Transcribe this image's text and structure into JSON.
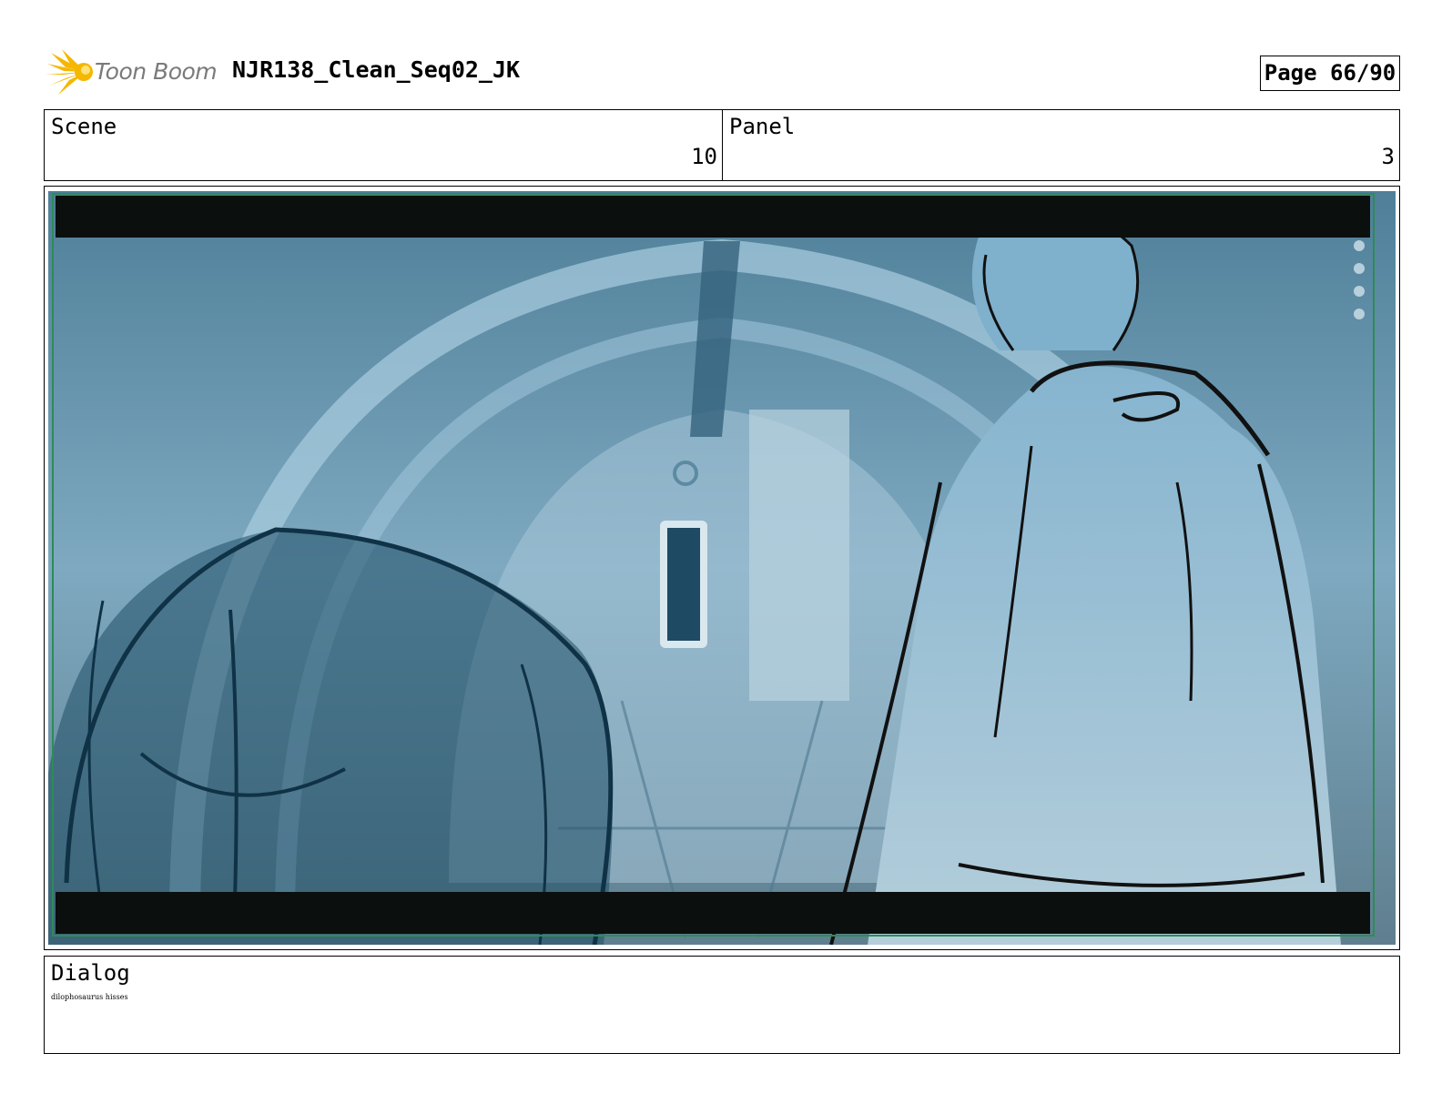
{
  "header": {
    "logo_text": "Toon Boom",
    "project_title": "NJR138_Clean_Seq02_JK",
    "page_label": "Page 66/90"
  },
  "info": {
    "scene_label": "Scene",
    "scene_value": "10",
    "panel_label": "Panel",
    "panel_value": "3"
  },
  "dialog": {
    "label": "Dialog",
    "text": "dilophosaurus hisses"
  },
  "colors": {
    "logo_accent": "#f5b700",
    "frame_border": "#2e8b57",
    "letterbox": "#0b0f0e",
    "scene_tint": "#6f9fb8"
  }
}
